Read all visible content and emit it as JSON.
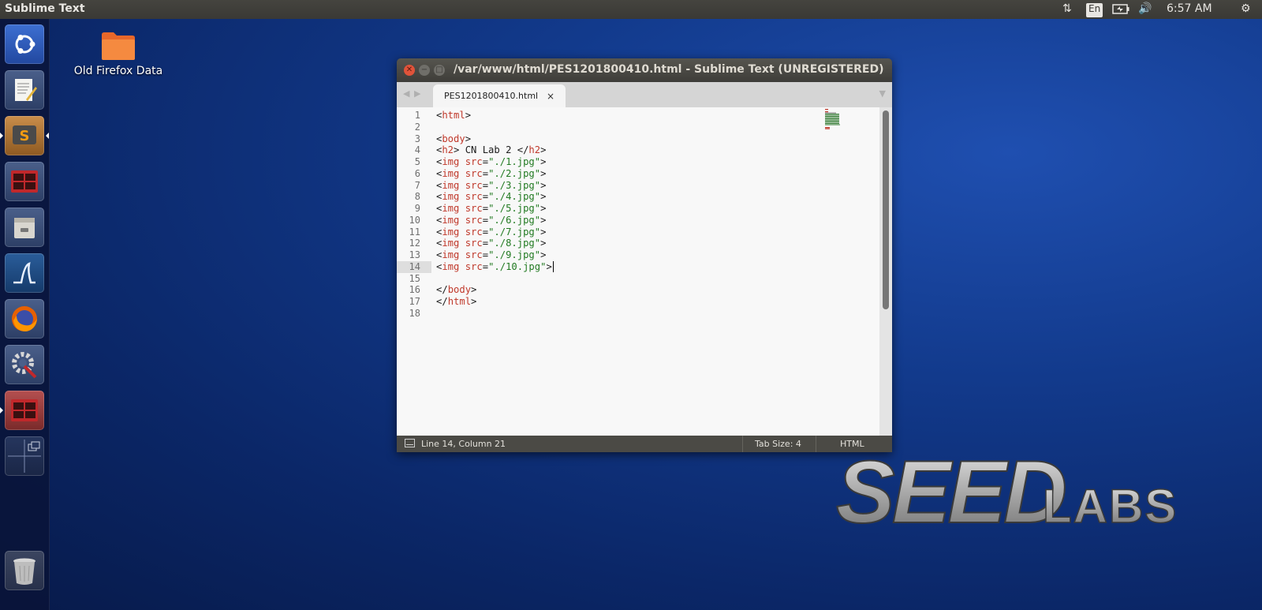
{
  "top_panel": {
    "app_title": "Sublime Text",
    "lang": "En",
    "clock": "6:57 AM"
  },
  "desktop": {
    "folder_label": "Old Firefox Data"
  },
  "window": {
    "title": "/var/www/html/PES1201800410.html - Sublime Text (UNREGISTERED)",
    "tab_label": "PES1201800410.html",
    "tab_close": "×",
    "current_line": 14
  },
  "editor": {
    "line_numbers": [
      "1",
      "2",
      "3",
      "4",
      "5",
      "6",
      "7",
      "8",
      "9",
      "10",
      "11",
      "12",
      "13",
      "14",
      "15",
      "16",
      "17",
      "18"
    ],
    "lines": [
      [
        {
          "t": "<"
        },
        {
          "t": "html",
          "c": "tag"
        },
        {
          "t": ">"
        }
      ],
      [],
      [
        {
          "t": "<"
        },
        {
          "t": "body",
          "c": "tag"
        },
        {
          "t": ">"
        }
      ],
      [
        {
          "t": "<"
        },
        {
          "t": "h2",
          "c": "tag"
        },
        {
          "t": "> CN Lab 2 </"
        },
        {
          "t": "h2",
          "c": "tag"
        },
        {
          "t": ">"
        }
      ],
      [
        {
          "t": "<"
        },
        {
          "t": "img",
          "c": "tag"
        },
        {
          "t": " "
        },
        {
          "t": "src",
          "c": "tag"
        },
        {
          "t": "="
        },
        {
          "t": "\"./1.jpg\"",
          "c": "str"
        },
        {
          "t": ">"
        }
      ],
      [
        {
          "t": "<"
        },
        {
          "t": "img",
          "c": "tag"
        },
        {
          "t": " "
        },
        {
          "t": "src",
          "c": "tag"
        },
        {
          "t": "="
        },
        {
          "t": "\"./2.jpg\"",
          "c": "str"
        },
        {
          "t": ">"
        }
      ],
      [
        {
          "t": "<"
        },
        {
          "t": "img",
          "c": "tag"
        },
        {
          "t": " "
        },
        {
          "t": "src",
          "c": "tag"
        },
        {
          "t": "="
        },
        {
          "t": "\"./3.jpg\"",
          "c": "str"
        },
        {
          "t": ">"
        }
      ],
      [
        {
          "t": "<"
        },
        {
          "t": "img",
          "c": "tag"
        },
        {
          "t": " "
        },
        {
          "t": "src",
          "c": "tag"
        },
        {
          "t": "="
        },
        {
          "t": "\"./4.jpg\"",
          "c": "str"
        },
        {
          "t": ">"
        }
      ],
      [
        {
          "t": "<"
        },
        {
          "t": "img",
          "c": "tag"
        },
        {
          "t": " "
        },
        {
          "t": "src",
          "c": "tag"
        },
        {
          "t": "="
        },
        {
          "t": "\"./5.jpg\"",
          "c": "str"
        },
        {
          "t": ">"
        }
      ],
      [
        {
          "t": "<"
        },
        {
          "t": "img",
          "c": "tag"
        },
        {
          "t": " "
        },
        {
          "t": "src",
          "c": "tag"
        },
        {
          "t": "="
        },
        {
          "t": "\"./6.jpg\"",
          "c": "str"
        },
        {
          "t": ">"
        }
      ],
      [
        {
          "t": "<"
        },
        {
          "t": "img",
          "c": "tag"
        },
        {
          "t": " "
        },
        {
          "t": "src",
          "c": "tag"
        },
        {
          "t": "="
        },
        {
          "t": "\"./7.jpg\"",
          "c": "str"
        },
        {
          "t": ">"
        }
      ],
      [
        {
          "t": "<"
        },
        {
          "t": "img",
          "c": "tag"
        },
        {
          "t": " "
        },
        {
          "t": "src",
          "c": "tag"
        },
        {
          "t": "="
        },
        {
          "t": "\"./8.jpg\"",
          "c": "str"
        },
        {
          "t": ">"
        }
      ],
      [
        {
          "t": "<"
        },
        {
          "t": "img",
          "c": "tag"
        },
        {
          "t": " "
        },
        {
          "t": "src",
          "c": "tag"
        },
        {
          "t": "="
        },
        {
          "t": "\"./9.jpg\"",
          "c": "str"
        },
        {
          "t": ">"
        }
      ],
      [
        {
          "t": "<"
        },
        {
          "t": "img",
          "c": "tag"
        },
        {
          "t": " "
        },
        {
          "t": "src",
          "c": "tag"
        },
        {
          "t": "="
        },
        {
          "t": "\"./10.jpg\"",
          "c": "str"
        },
        {
          "t": ">"
        }
      ],
      [],
      [
        {
          "t": "</"
        },
        {
          "t": "body",
          "c": "tag"
        },
        {
          "t": ">"
        }
      ],
      [
        {
          "t": "</"
        },
        {
          "t": "html",
          "c": "tag"
        },
        {
          "t": ">"
        }
      ],
      []
    ]
  },
  "status_bar": {
    "position": "Line 14, Column 21",
    "tab_size": "Tab Size: 4",
    "syntax": "HTML"
  },
  "launcher": {
    "items": [
      "ubuntu-dash-icon",
      "text-editor-icon",
      "sublime-text-icon",
      "terminal-icon",
      "file-manager-icon",
      "wireshark-icon",
      "firefox-icon",
      "system-settings-icon",
      "terminal-icon",
      "workspace-switcher-icon"
    ],
    "trash": "trash-icon"
  },
  "wallpaper_logo": {
    "big": "SEED",
    "small": "LABS"
  },
  "colors": {
    "tag": "#c0392b",
    "string": "#217a21",
    "close_button": "#e0533a"
  }
}
